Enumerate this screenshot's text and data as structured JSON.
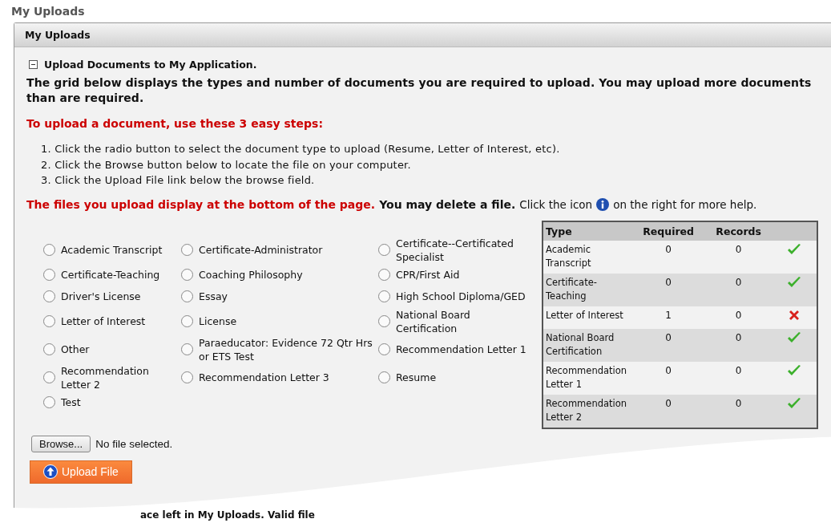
{
  "page_title": "My Uploads",
  "panel": {
    "title": "My Uploads",
    "section": {
      "title": "Upload Documents to My Application.",
      "expanded": true
    },
    "intro": "The grid below displays the types and number of documents you are required to upload. You may upload more documents than are required.",
    "steps_heading": "To upload a document, use these 3 easy steps:",
    "steps": [
      "1. Click the radio button to select the document type to upload (Resume, Letter of Interest, etc).",
      "2. Click the Browse button below to locate the file on your computer.",
      "3. Click the Upload File link below the browse field."
    ],
    "notice": {
      "warning": "The files you upload display at the bottom of the page.",
      "bold": "You may delete a file.",
      "help_before": "Click the icon",
      "help_after": "on the right for more help."
    },
    "document_types": [
      {
        "label": "Academic Transcript",
        "selected": false
      },
      {
        "label": "Certificate-Administrator",
        "selected": false
      },
      {
        "label": "Certificate--Certificated Specialist",
        "selected": false
      },
      {
        "label": "Certificate-Teaching",
        "selected": false
      },
      {
        "label": "Coaching Philosophy",
        "selected": false
      },
      {
        "label": "CPR/First Aid",
        "selected": false
      },
      {
        "label": "Driver's License",
        "selected": false
      },
      {
        "label": "Essay",
        "selected": false
      },
      {
        "label": "High School Diploma/GED",
        "selected": false
      },
      {
        "label": "Letter of Interest",
        "selected": false
      },
      {
        "label": "License",
        "selected": false
      },
      {
        "label": "National Board Certification",
        "selected": false
      },
      {
        "label": "Other",
        "selected": false
      },
      {
        "label": "Paraeducator: Evidence 72 Qtr Hrs or ETS Test",
        "selected": false
      },
      {
        "label": "Recommendation Letter 1",
        "selected": false
      },
      {
        "label": "Recommendation Letter 2",
        "selected": false
      },
      {
        "label": "Recommendation Letter 3",
        "selected": false
      },
      {
        "label": "Resume",
        "selected": false
      },
      {
        "label": "Test",
        "selected": false
      }
    ],
    "table": {
      "columns": [
        "Type",
        "Required",
        "Records"
      ],
      "rows": [
        {
          "type": "Academic Transcript",
          "required": "0",
          "records": "0",
          "complete": true
        },
        {
          "type": "Certificate-Teaching",
          "required": "0",
          "records": "0",
          "complete": true
        },
        {
          "type": "Letter of Interest",
          "required": "1",
          "records": "0",
          "complete": false
        },
        {
          "type": "National Board Certification",
          "required": "0",
          "records": "0",
          "complete": true
        },
        {
          "type": "Recommendation Letter 1",
          "required": "0",
          "records": "0",
          "complete": true
        },
        {
          "type": "Recommendation Letter 2",
          "required": "0",
          "records": "0",
          "complete": true
        }
      ]
    },
    "browse_button": "Browse...",
    "file_status": "No file selected.",
    "upload_button": "Upload File",
    "footer_fragment": "ace left in My Uploads. Valid file"
  }
}
